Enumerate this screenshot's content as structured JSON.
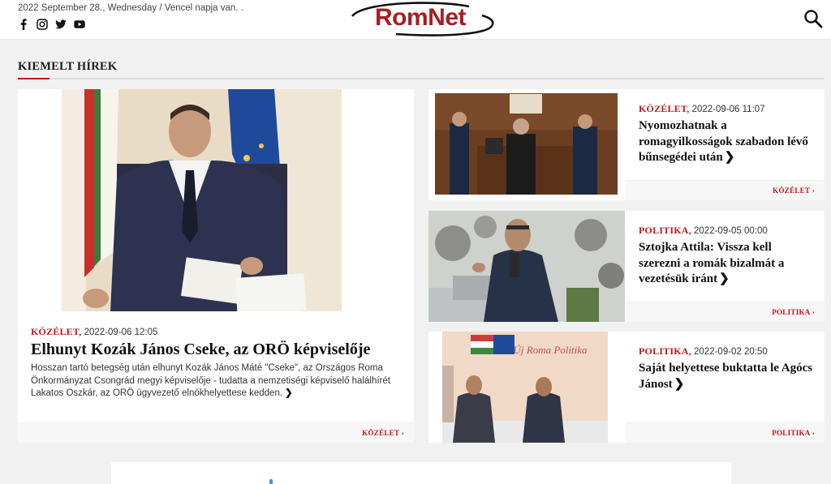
{
  "header": {
    "date_text": "2022 September 28., Wednesday / Vencel napja van. .",
    "logo_text": "RomNet",
    "social_icons": [
      "facebook-icon",
      "instagram-icon",
      "twitter-icon",
      "youtube-icon"
    ],
    "search_icon": "search-icon"
  },
  "section": {
    "title": "KIEMELT HÍREK"
  },
  "featured": {
    "category": "KÖZÉLET,",
    "datetime": "2022-09-06 12:05",
    "title": "Elhunyt Kozák János Cseke, az ORÖ képviselője",
    "excerpt": "Hosszan tartó betegség után elhunyt Kozák János Máté \"Cseke\", az Országos Roma Önkormányzat Csongrád megyi képviselője - tudatta a nemzetiségi képviselő halálhírét Lakatos Oszkár, az ORÖ ügyvezető elnökhelyettese kedden.",
    "footer_tag": "KÖZÉLET"
  },
  "side_articles": [
    {
      "category": "KÖZÉLET,",
      "datetime": "2022-09-06 11:07",
      "title": "Nyomozhatnak a romagyilkosságok szabadon lévő bűnsegédei után",
      "footer_tag": "KÖZÉLET"
    },
    {
      "category": "POLITIKA,",
      "datetime": "2022-09-05 00:00",
      "title": "Sztojka Attila: Vissza kell szerezni a romák bizalmát a vezetésük iránt",
      "footer_tag": "POLITIKA"
    },
    {
      "category": "POLITIKA,",
      "datetime": "2022-09-02 20:50",
      "title": "Saját helyettese buktatta le Agócs Jánost",
      "footer_tag": "POLITIKA",
      "banner_text": "Új Roma Politika"
    }
  ],
  "glyphs": {
    "chevron": "❯",
    "footer_chevron": "›"
  },
  "colors": {
    "accent_red": "#c4161c",
    "logo_red": "#a61e23",
    "background": "#f1f1f1"
  }
}
